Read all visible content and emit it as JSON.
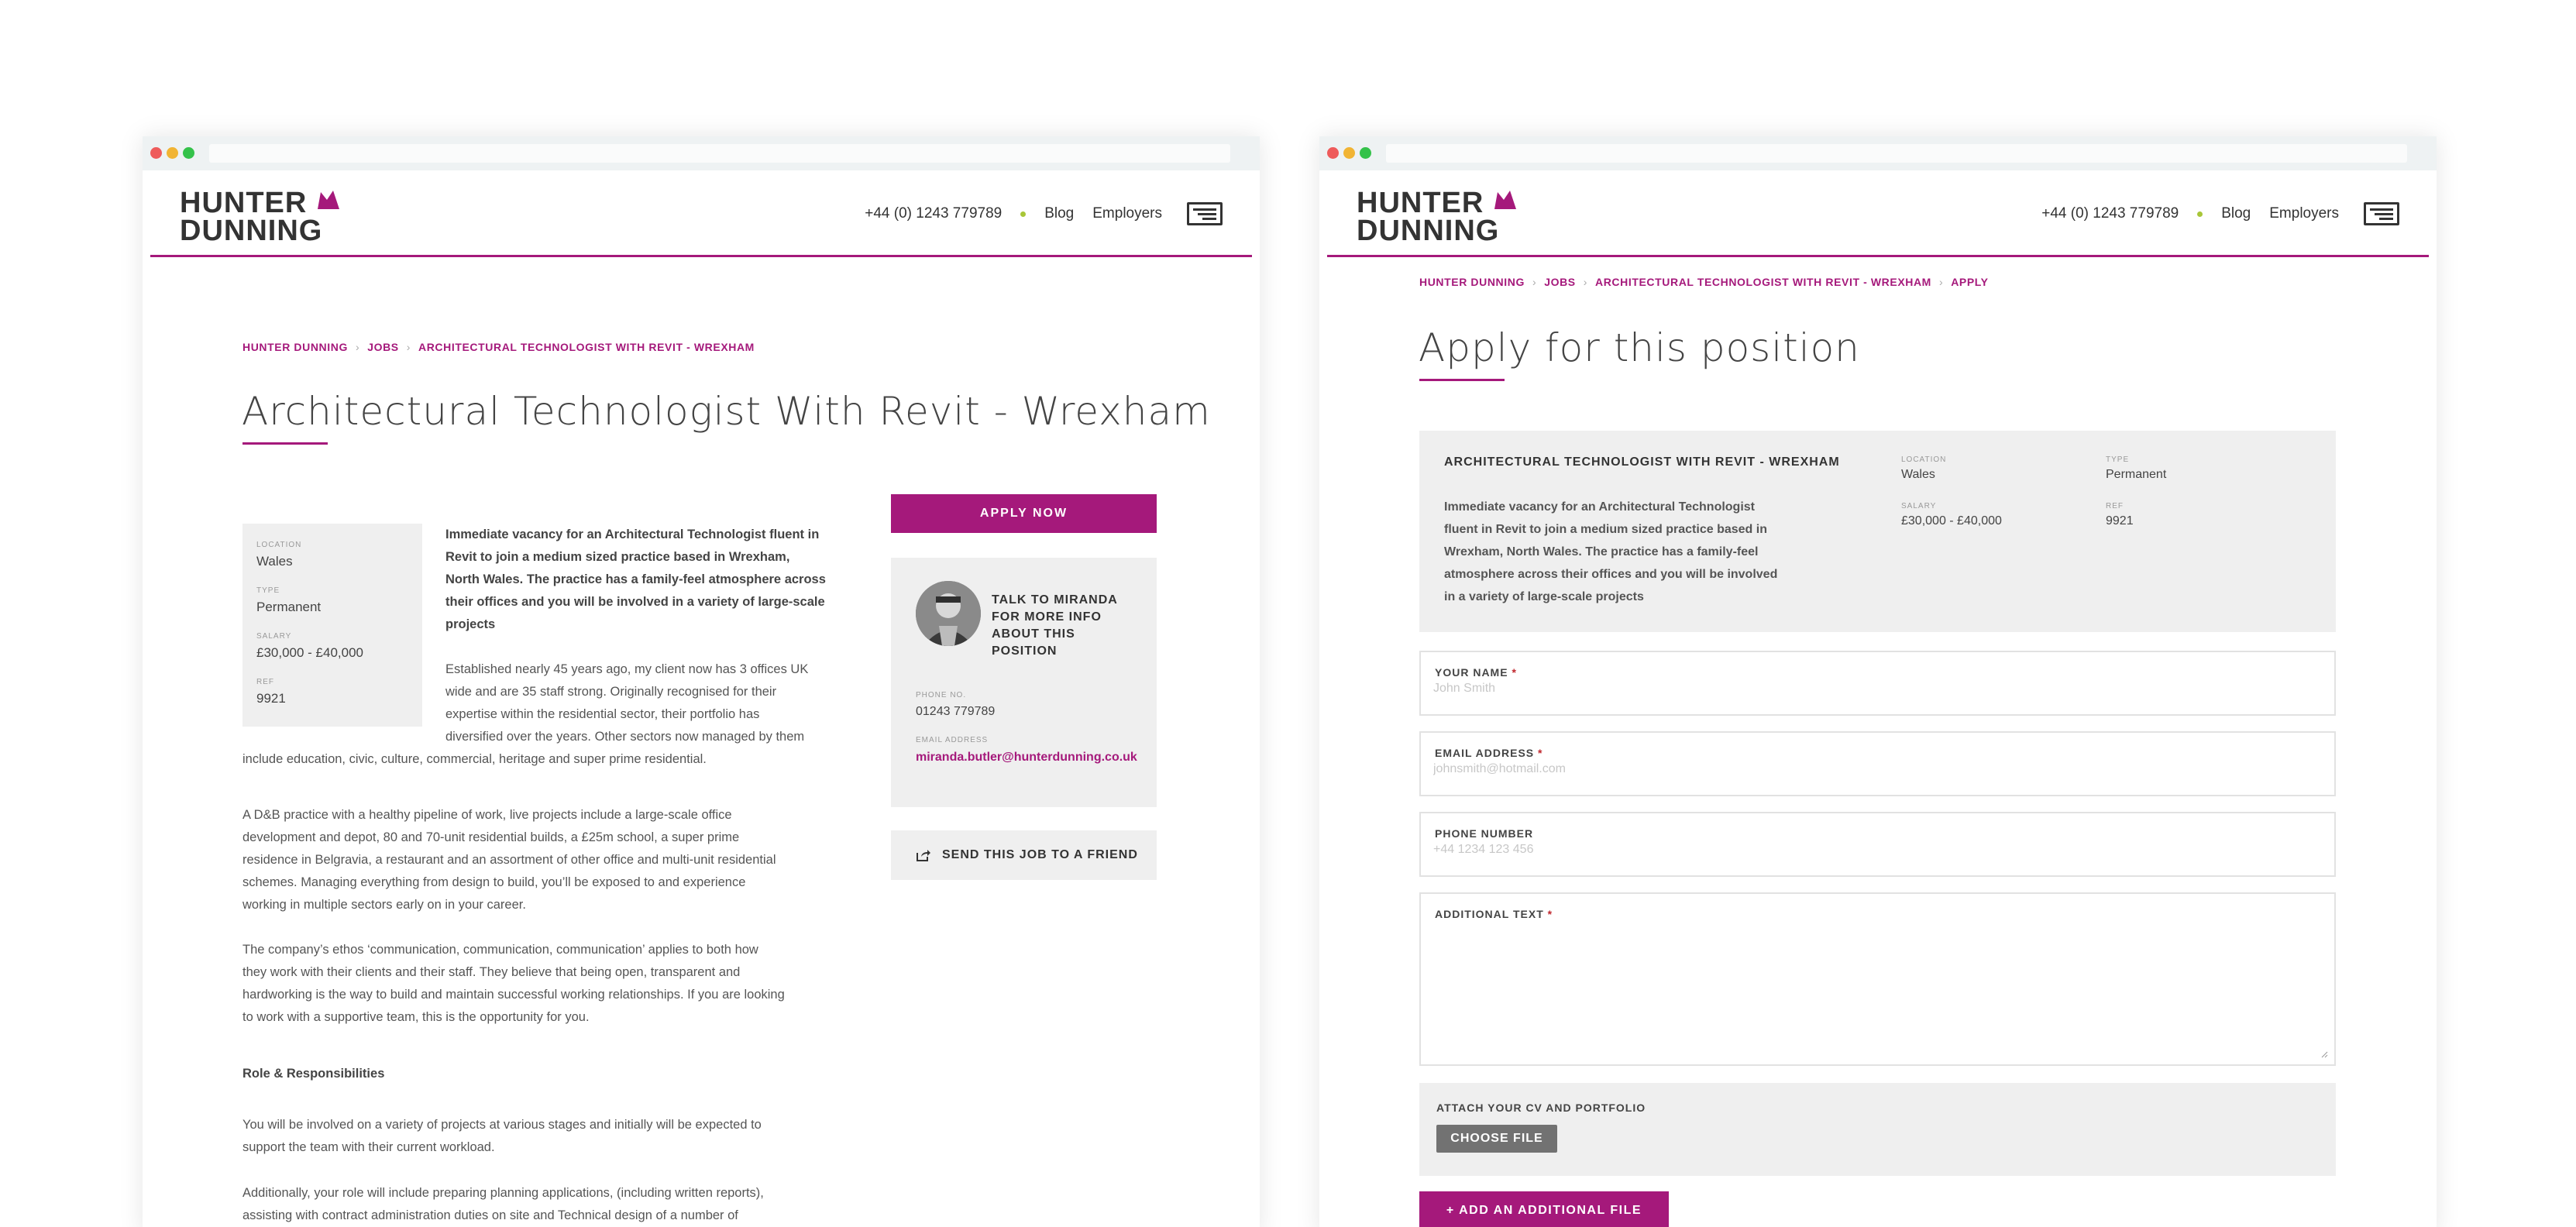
{
  "brand": {
    "logo_line1": "HUNTER",
    "logo_line2": "DUNNING",
    "accent": "#a5197b",
    "nav_dot_color": "#a8c638"
  },
  "nav": {
    "phone": "+44 (0) 1243 779789",
    "links": [
      "Blog",
      "Employers"
    ],
    "menu_icon": "hamburger-menu-icon"
  },
  "left": {
    "breadcrumb": [
      "HUNTER DUNNING",
      "JOBS",
      "ARCHITECTURAL TECHNOLOGIST WITH REVIT - WREXHAM"
    ],
    "title": "Architectural Technologist With Revit - Wrexham",
    "meta": [
      {
        "key": "LOCATION",
        "value": "Wales"
      },
      {
        "key": "TYPE",
        "value": "Permanent"
      },
      {
        "key": "SALARY",
        "value": "£30,000 - £40,000"
      },
      {
        "key": "REF",
        "value": "9921"
      }
    ],
    "intro_lines": [
      "Immediate vacancy for an Architectural Technologist fluent in",
      "Revit to join a medium sized practice based in Wrexham,",
      "North Wales. The practice has a family-feel atmosphere across",
      "their offices and you will be involved in a variety of large-scale",
      "projects"
    ],
    "para1_lines": [
      "Established nearly 45 years ago, my client now has 3 offices UK",
      "wide and are 35 staff strong. Originally recognised for their",
      "expertise within the residential sector, their portfolio has",
      "diversified over the years. Other sectors now managed by them"
    ],
    "para1_full": "include education, civic, culture, commercial, heritage and super prime residential.",
    "para2": [
      "A D&B practice with a healthy pipeline of work, live projects include a large-scale office",
      "development and depot, 80 and 70-unit residential builds, a £25m school, a super prime",
      "residence in Belgravia, a restaurant and an assortment of other office and multi-unit residential",
      "schemes. Managing everything from design to build, you’ll be exposed to and experience",
      "working in multiple sectors early on in your career."
    ],
    "para3": [
      "The company’s ethos ‘communication, communication, communication’ applies to both how",
      "they work with their clients and their staff. They believe that being open, transparent and",
      "hardworking is the way to build and maintain successful working relationships. If you are looking",
      "to work with a supportive team, this is the opportunity for you."
    ],
    "role_heading": "Role & Responsibilities",
    "para4": [
      "You will be involved on a variety of projects at various stages and initially will be expected to",
      "support the team with their current workload."
    ],
    "para5": [
      "Additionally, your role will include preparing planning applications, (including written reports),",
      "assisting with contract administration duties on site and Technical design of a number of"
    ],
    "apply_label": "APPLY NOW",
    "contact": {
      "title": "TALK TO MIRANDA FOR MORE INFO ABOUT THIS POSITION",
      "phone_key": "PHONE NO.",
      "phone": "01243 779789",
      "email_key": "EMAIL ADDRESS",
      "email": "miranda.butler@hunterdunning.co.uk"
    },
    "send_friend_label": "SEND THIS JOB TO A FRIEND"
  },
  "right": {
    "breadcrumb": [
      "HUNTER DUNNING",
      "JOBS",
      "ARCHITECTURAL TECHNOLOGIST WITH REVIT - WREXHAM",
      "APPLY"
    ],
    "title": "Apply for this position",
    "job_title": "ARCHITECTURAL TECHNOLOGIST WITH REVIT - WREXHAM",
    "job_desc_lines": [
      "Immediate vacancy for an Architectural Technologist",
      "fluent in Revit to join a medium sized practice based in",
      "Wrexham, North Wales. The practice has a family-feel",
      "atmosphere across their offices and you will be involved",
      "in a variety of large-scale projects"
    ],
    "meta": [
      {
        "key": "LOCATION",
        "value": "Wales"
      },
      {
        "key": "TYPE",
        "value": "Permanent"
      },
      {
        "key": "SALARY",
        "value": "£30,000 - £40,000"
      },
      {
        "key": "REF",
        "value": "9921"
      }
    ],
    "form": {
      "name_label": "YOUR NAME",
      "name_placeholder": "John Smith",
      "email_label": "EMAIL ADDRESS",
      "email_placeholder": "johnsmith@hotmail.com",
      "phone_label": "PHONE NUMBER",
      "phone_placeholder": "+44 1234 123 456",
      "text_label": "ADDITIONAL TEXT",
      "required_mark": "*",
      "attach_label": "ATTACH YOUR CV AND PORTFOLIO",
      "choose_label": "CHOOSE FILE",
      "add_file_label": "+ ADD AN ADDITIONAL FILE"
    }
  }
}
